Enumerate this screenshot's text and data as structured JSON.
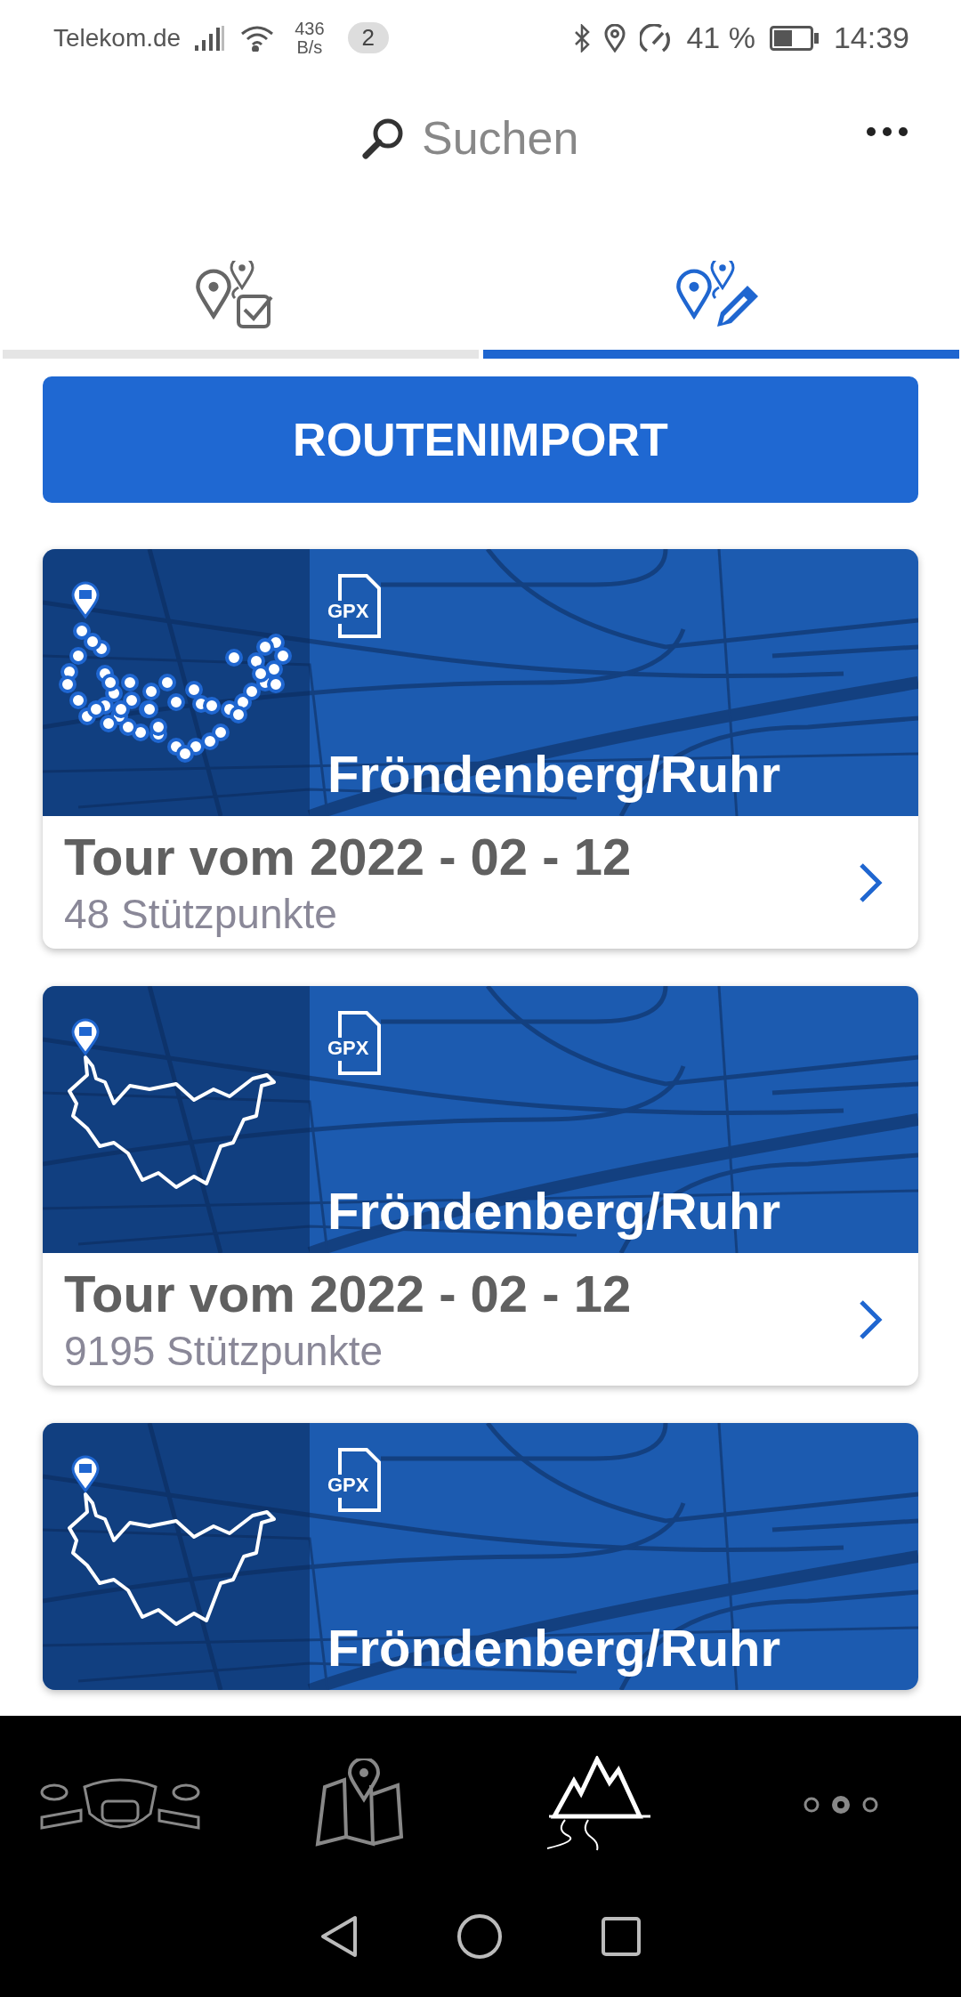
{
  "status_bar": {
    "carrier": "Telekom.de",
    "speed_value": "436",
    "speed_unit": "B/s",
    "notification_count": "2",
    "battery_percent": "41 %",
    "time": "14:39"
  },
  "search": {
    "placeholder": "Suchen"
  },
  "tabs": [
    {
      "kind": "planned",
      "selected": false
    },
    {
      "kind": "edit",
      "selected": true
    }
  ],
  "import_button": "ROUTENIMPORT",
  "routes": [
    {
      "kind": "dots",
      "file_type": "GPX",
      "location": "Fröndenberg/Ruhr",
      "title": "Tour vom 2022 - 02 - 12",
      "waypoints": "48 Stützpunkte"
    },
    {
      "kind": "line",
      "file_type": "GPX",
      "location": "Fröndenberg/Ruhr",
      "title": "Tour vom 2022 - 02 - 12",
      "waypoints": "9195 Stützpunkte"
    },
    {
      "kind": "line",
      "file_type": "GPX",
      "location": "Fröndenberg/Ruhr"
    }
  ],
  "bottom_nav": [
    {
      "kind": "handlebar",
      "selected": false
    },
    {
      "kind": "map",
      "selected": false
    },
    {
      "kind": "mountains",
      "selected": true
    },
    {
      "kind": "more",
      "selected": false
    }
  ]
}
